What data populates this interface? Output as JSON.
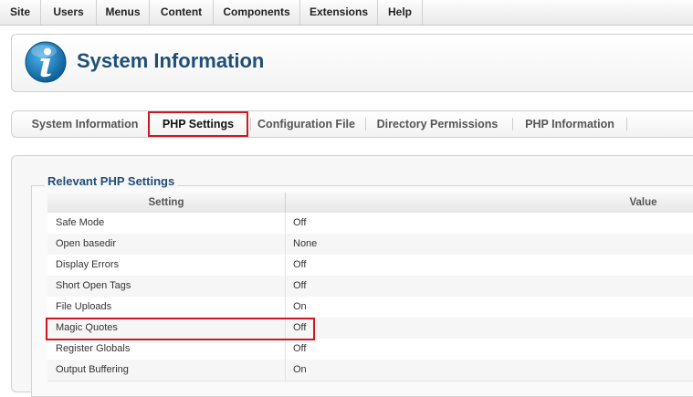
{
  "menu": [
    "Site",
    "Users",
    "Menus",
    "Content",
    "Components",
    "Extensions",
    "Help"
  ],
  "header": {
    "title": "System Information",
    "icon": "info-icon"
  },
  "tabs": [
    {
      "label": "System Information",
      "active": false
    },
    {
      "label": "PHP Settings",
      "active": true
    },
    {
      "label": "Configuration File",
      "active": false
    },
    {
      "label": "Directory Permissions",
      "active": false
    },
    {
      "label": "PHP Information",
      "active": false
    }
  ],
  "settings": {
    "legend": "Relevant PHP Settings",
    "columns": [
      "Setting",
      "Value"
    ],
    "rows": [
      {
        "setting": "Safe Mode",
        "value": "Off"
      },
      {
        "setting": "Open basedir",
        "value": "None"
      },
      {
        "setting": "Display Errors",
        "value": "Off"
      },
      {
        "setting": "Short Open Tags",
        "value": "Off"
      },
      {
        "setting": "File Uploads",
        "value": "On"
      },
      {
        "setting": "Magic Quotes",
        "value": "Off"
      },
      {
        "setting": "Register Globals",
        "value": "Off"
      },
      {
        "setting": "Output Buffering",
        "value": "On"
      }
    ]
  },
  "colors": {
    "accent": "#1f4e79",
    "highlight": "#d0161e",
    "icon": "#1a7fc1"
  }
}
